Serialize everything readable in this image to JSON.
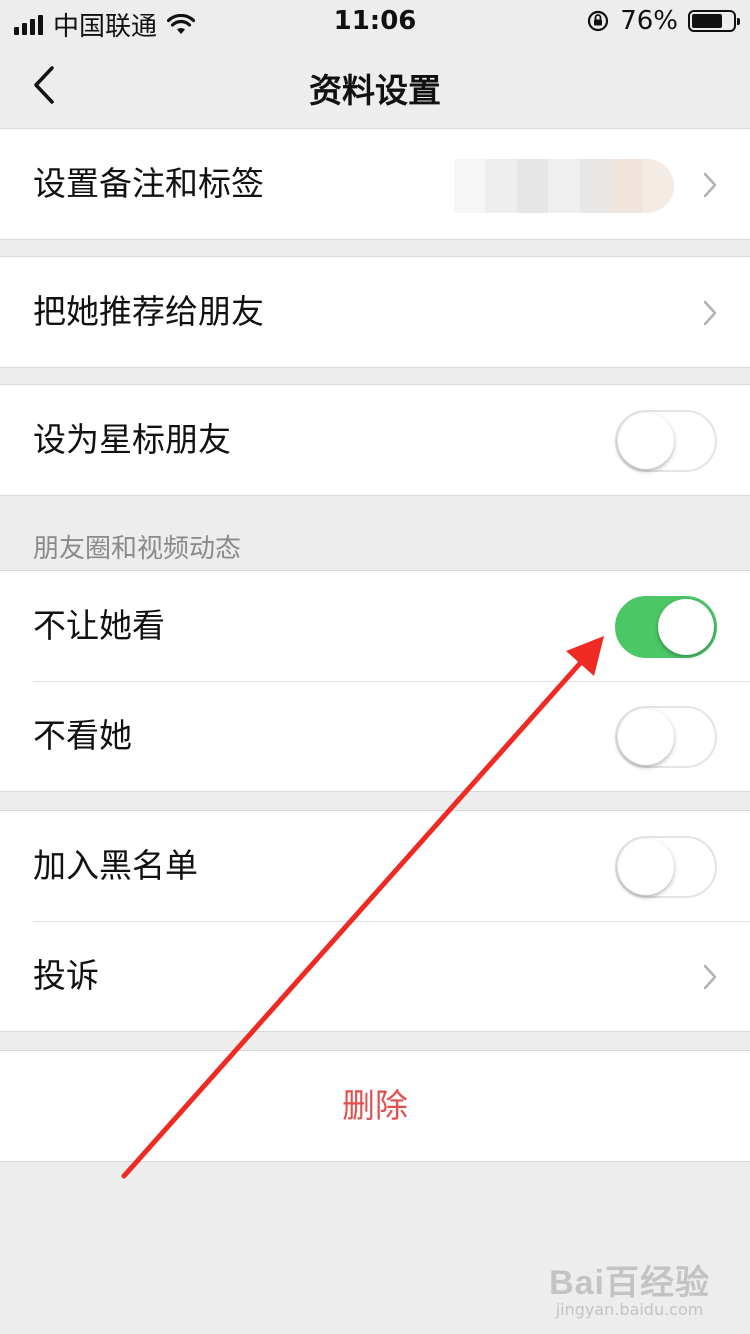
{
  "status_bar": {
    "carrier": "中国联通",
    "time": "11:06",
    "battery_text": "76%",
    "battery_level": 0.76
  },
  "nav": {
    "title": "资料设置",
    "back_icon": "chevron-left-icon"
  },
  "groups": {
    "remark": {
      "label": "设置备注和标签"
    },
    "recommend": {
      "label": "把她推荐给朋友"
    },
    "star": {
      "label": "设为星标朋友",
      "toggle_on": false
    }
  },
  "moments": {
    "section_title": "朋友圈和视频动态",
    "hide_my_posts": {
      "label": "不让她看",
      "toggle_on": true
    },
    "hide_her_posts": {
      "label": "不看她",
      "toggle_on": false
    }
  },
  "safety": {
    "blacklist": {
      "label": "加入黑名单",
      "toggle_on": false
    },
    "report": {
      "label": "投诉"
    }
  },
  "delete": {
    "label": "删除"
  },
  "watermark": {
    "brand": "Bai百经验",
    "url": "jingyan.baidu.com"
  },
  "colors": {
    "toggle_on": "#4cc766",
    "delete_text": "#e0504f",
    "annotation_arrow": "#ee2a22",
    "background": "#ededed"
  }
}
